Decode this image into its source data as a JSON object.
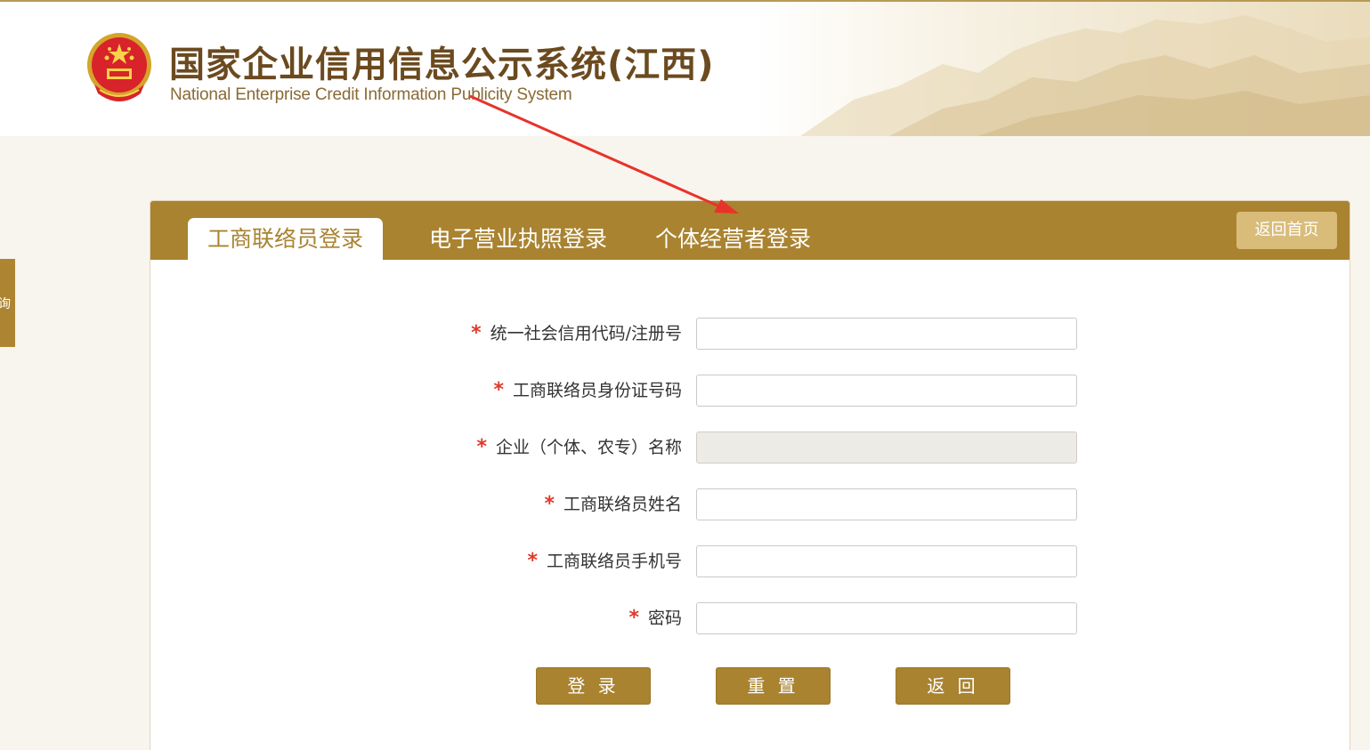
{
  "header": {
    "title": "国家企业信用信息公示系统(江西)",
    "subtitle": "National Enterprise Credit Information Publicity System",
    "emblem_icon": "national-emblem-icon"
  },
  "side_tab": {
    "label": "询"
  },
  "tabs": [
    {
      "label": "工商联络员登录",
      "active": true
    },
    {
      "label": "电子营业执照登录",
      "active": false
    },
    {
      "label": "个体经营者登录",
      "active": false
    }
  ],
  "home_button": "返回首页",
  "form": {
    "required_mark": "*",
    "fields": [
      {
        "label": "统一社会信用代码/注册号",
        "value": "",
        "disabled": false
      },
      {
        "label": "工商联络员身份证号码",
        "value": "",
        "disabled": false
      },
      {
        "label": "企业（个体、农专）名称",
        "value": "",
        "disabled": true
      },
      {
        "label": "工商联络员姓名",
        "value": "",
        "disabled": false
      },
      {
        "label": "工商联络员手机号",
        "value": "",
        "disabled": false
      },
      {
        "label": "密码",
        "value": "",
        "disabled": false
      }
    ]
  },
  "buttons": {
    "login": "登 录",
    "reset": "重 置",
    "back": "返 回"
  },
  "colors": {
    "accent": "#a98330",
    "required": "#e0392b",
    "annotation_arrow": "#e8332a"
  }
}
